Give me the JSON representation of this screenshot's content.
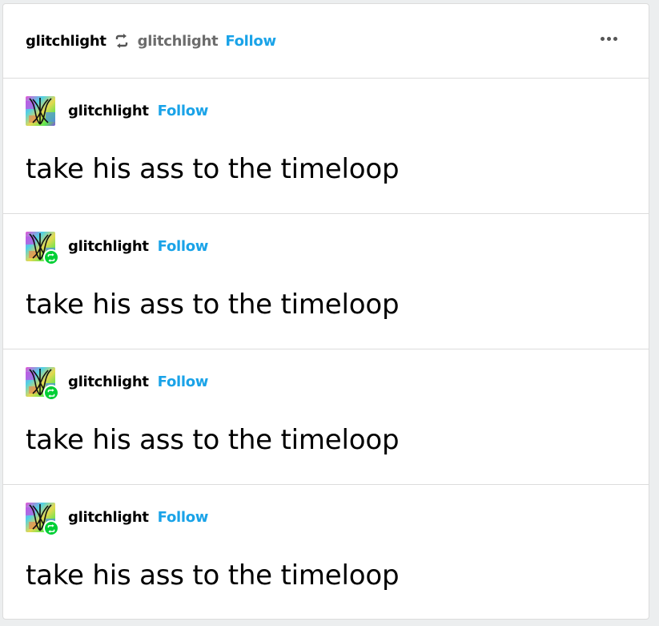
{
  "header": {
    "blog_name": "glitchlight",
    "reblog_icon": "reblog-icon",
    "reblogged_from": "glitchlight",
    "follow_label": "Follow",
    "more_icon": "more-options-icon"
  },
  "trail": [
    {
      "username": "glitchlight",
      "follow_label": "Follow",
      "text": "take his ass to the timeloop",
      "reblog_badge": false
    },
    {
      "username": "glitchlight",
      "follow_label": "Follow",
      "text": "take his ass to the timeloop",
      "reblog_badge": true
    },
    {
      "username": "glitchlight",
      "follow_label": "Follow",
      "text": "take his ass to the timeloop",
      "reblog_badge": true
    },
    {
      "username": "glitchlight",
      "follow_label": "Follow",
      "text": "take his ass to the timeloop",
      "reblog_badge": true
    }
  ],
  "colors": {
    "follow": "#1aa3e8",
    "badge": "#00cf35",
    "divider": "#dcdcdc",
    "secondary_text": "#6c6c6c"
  }
}
